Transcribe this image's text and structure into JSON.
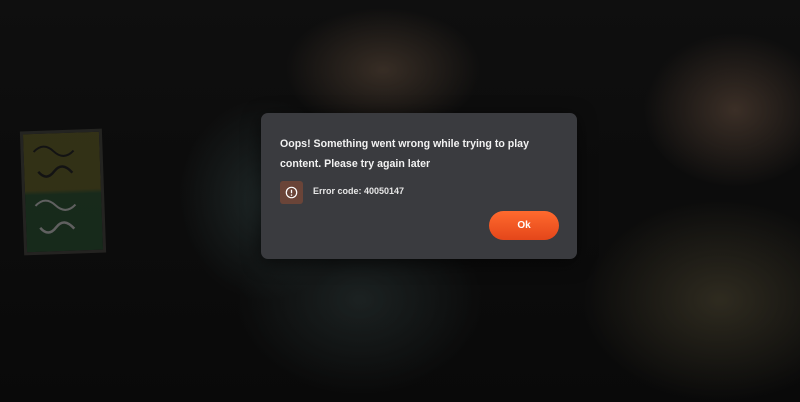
{
  "dialog": {
    "message": "Oops! Something went wrong while trying to play content. Please try again later",
    "error_label": "Error code: 40050147",
    "ok_label": "Ok",
    "error_icon": "alert-circle-icon",
    "accent_color": "#f05a24"
  },
  "background": {
    "description_icon": "poster-image"
  }
}
